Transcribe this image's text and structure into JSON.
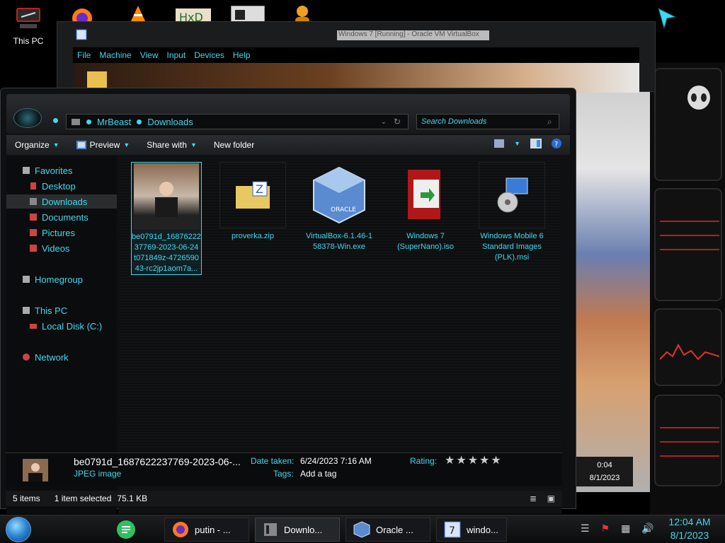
{
  "desktop": {
    "this_pc_label": "This PC"
  },
  "vbox": {
    "title": "Windows 7 [Running] - Oracle VM VirtualBox",
    "menu": [
      "File",
      "Machine",
      "View",
      "Input",
      "Devices",
      "Help"
    ]
  },
  "explorer": {
    "breadcrumb": [
      "MrBeast",
      "Downloads"
    ],
    "search_placeholder": "Search Downloads",
    "toolbar": {
      "organize": "Organize",
      "preview": "Preview",
      "share_with": "Share with",
      "new_folder": "New folder"
    },
    "nav": {
      "favorites": "Favorites",
      "desktop": "Desktop",
      "downloads": "Downloads",
      "documents": "Documents",
      "pictures": "Pictures",
      "videos": "Videos",
      "homegroup": "Homegroup",
      "this_pc": "This PC",
      "local_disk": "Local Disk (C:)",
      "network": "Network"
    },
    "files": [
      {
        "name": "be0791d_1687622237769-2023-06-24t071849z-472659043-rc2jp1aom7a...",
        "line1": "be0791d_16876222",
        "line2": "37769-2023-06-24",
        "line3": "t071849z-4726590",
        "line4": "43-rc2jp1aom7a..."
      },
      {
        "name": "proverka.zip"
      },
      {
        "name": "VirtualBox-6.1.46-158378-Win.exe",
        "line1": "VirtualBox-6.1.46-1",
        "line2": "58378-Win.exe"
      },
      {
        "name": "Windows 7 (SuperNano).iso",
        "line1": "Windows 7",
        "line2": "(SuperNano).iso"
      },
      {
        "name": "Windows Mobile 6 Standard Images (PLK).msi",
        "line1": "Windows Mobile 6",
        "line2": "Standard Images",
        "line3": "(PLK).msi"
      }
    ],
    "details": {
      "filename": "be0791d_1687622237769-2023-06-...",
      "filetype": "JPEG image",
      "date_taken_label": "Date taken:",
      "date_taken_value": "6/24/2023 7:16 AM",
      "tags_label": "Tags:",
      "tags_value": "Add a tag",
      "rating_label": "Rating:",
      "rating_stars": "★★★★★"
    },
    "status": {
      "items": "5 items",
      "selected": "1 item selected",
      "size": "75.1 KB"
    }
  },
  "clock_widget": {
    "time": "0:04",
    "date": "8/1/2023"
  },
  "taskbar": {
    "buttons": [
      "putin - ...",
      "Downlo...",
      "Oracle ...",
      "windo..."
    ],
    "time": "12:04 AM",
    "date": "8/1/2023"
  },
  "colors": {
    "accent": "#3fd9f0",
    "window_bg": "#0e1012",
    "alienware_red": "#e23030"
  }
}
